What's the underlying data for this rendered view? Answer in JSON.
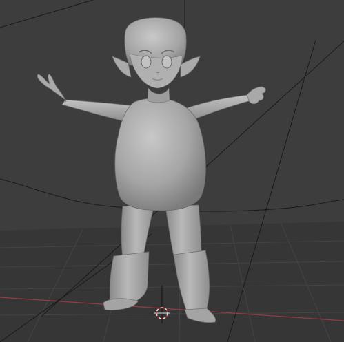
{
  "viewport": {
    "background_color": "#3d3d3d",
    "floor_color": "#363636",
    "grid_color": "#444444",
    "x_axis_color": "#9a3a48",
    "y_axis_color": "#7a8a3a",
    "model_color": "#a7a7a7",
    "model_shadow_color": "#6d6d6d",
    "model_highlight_color": "#c4c4c4",
    "lattice_line_color": "#1a1a1a",
    "cursor_color": "#e0e0e0",
    "cursor_accent_color": "#b22222"
  },
  "objects": {
    "model_name": "",
    "cursor_icon": "3d-cursor-icon"
  }
}
